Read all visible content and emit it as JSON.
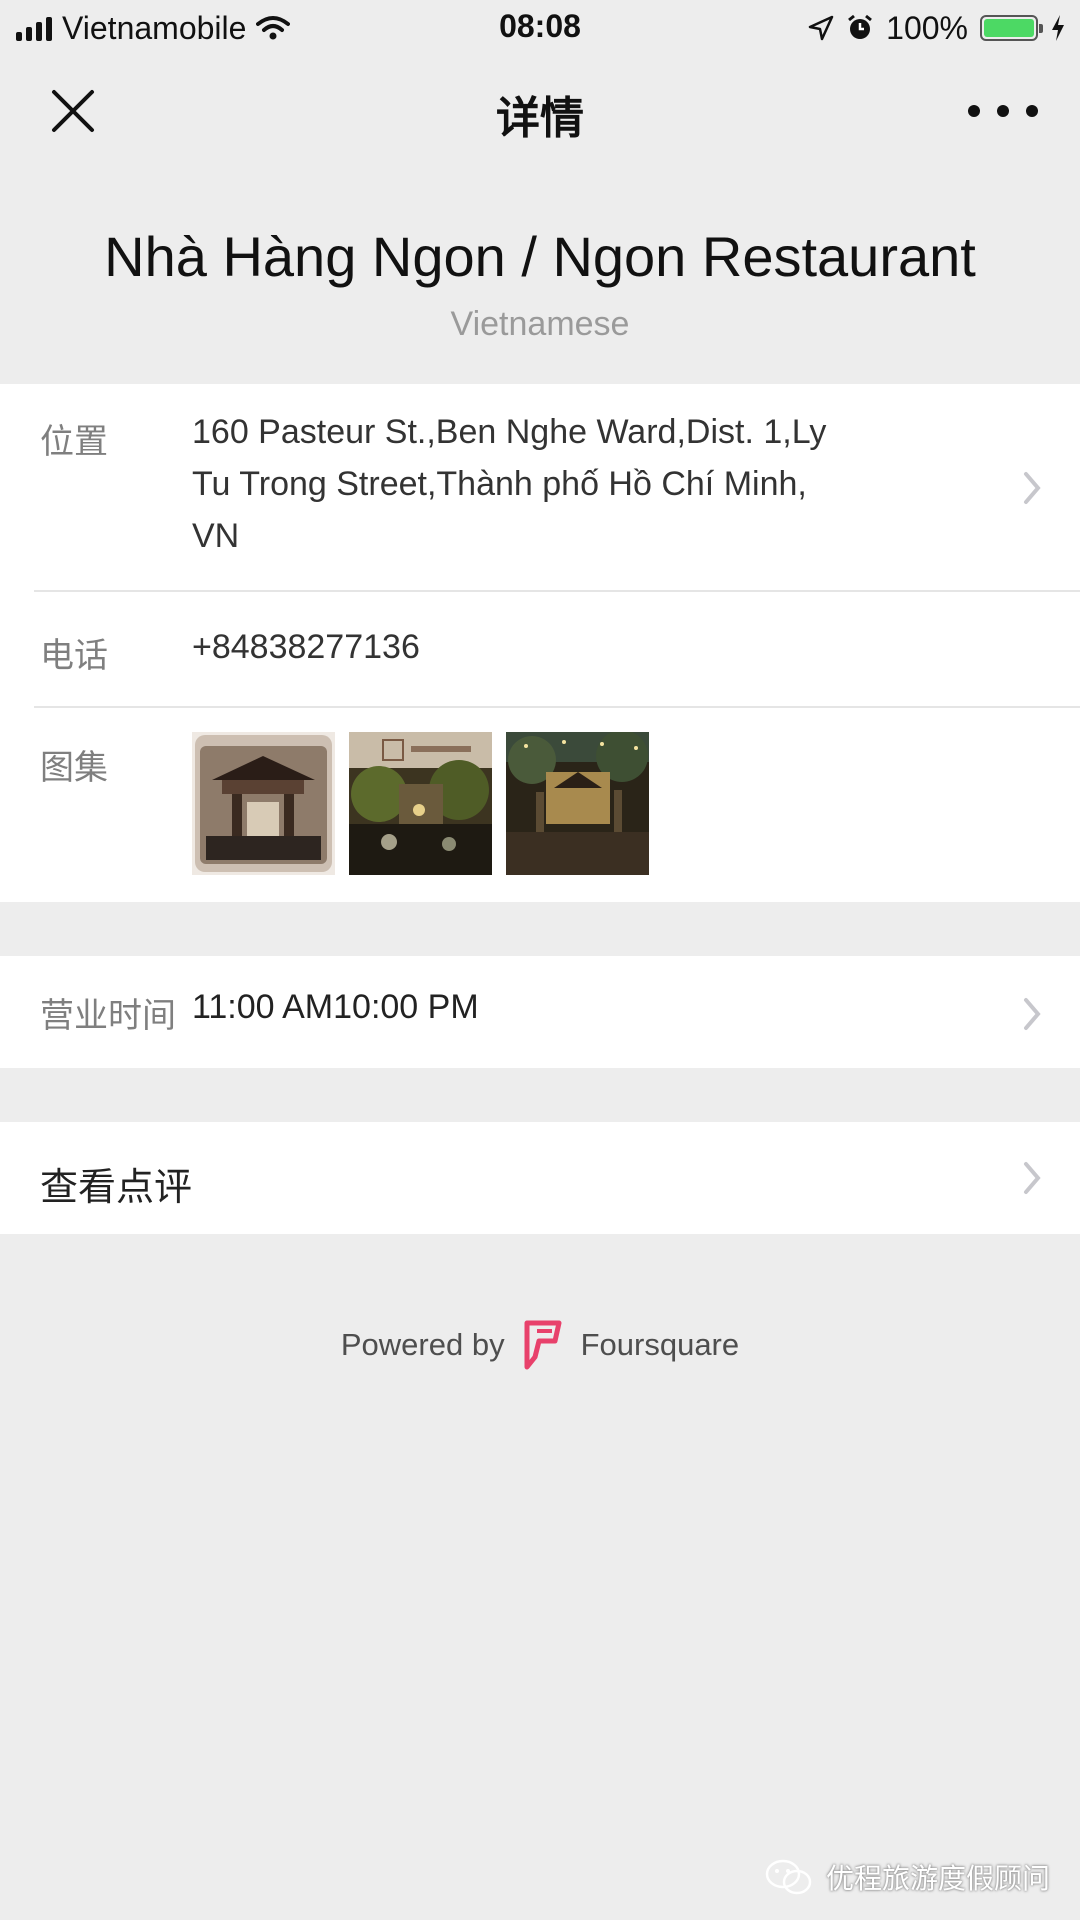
{
  "status_bar": {
    "carrier": "Vietnamobile",
    "time": "08:08",
    "battery_percent": "100%",
    "battery_level": 1.0,
    "icons": [
      "signal-bars-icon",
      "wifi-icon",
      "location-arrow-icon",
      "alarm-icon",
      "battery-icon",
      "charging-bolt-icon"
    ]
  },
  "nav": {
    "title": "详情",
    "close_icon": "close-icon",
    "more_icon": "more-dots-icon"
  },
  "place": {
    "name": "Nhà Hàng Ngon / Ngon Restaurant",
    "category": "Vietnamese"
  },
  "details": {
    "location_label": "位置",
    "address_lines": [
      "160 Pasteur St.,Ben Nghe Ward,Dist. 1,Ly",
      "Tu Trong Street,Thành phố Hồ Chí Minh,",
      "VN"
    ],
    "phone_label": "电话",
    "phone": "+84838277136",
    "gallery_label": "图集",
    "gallery_count": 3
  },
  "hours": {
    "label": "营业时间",
    "value": "11:00 AM10:00 PM"
  },
  "reviews": {
    "label": "查看点评"
  },
  "footer": {
    "powered_by": "Powered by",
    "brand": "Foursquare",
    "brand_color": "#e8416b"
  },
  "watermark": {
    "text": "优程旅游度假顾问"
  },
  "colors": {
    "background": "#ededed",
    "card": "#ffffff",
    "label": "#7f7f7f",
    "chevron": "#c7c7cc",
    "battery_fill": "#4cd964"
  }
}
